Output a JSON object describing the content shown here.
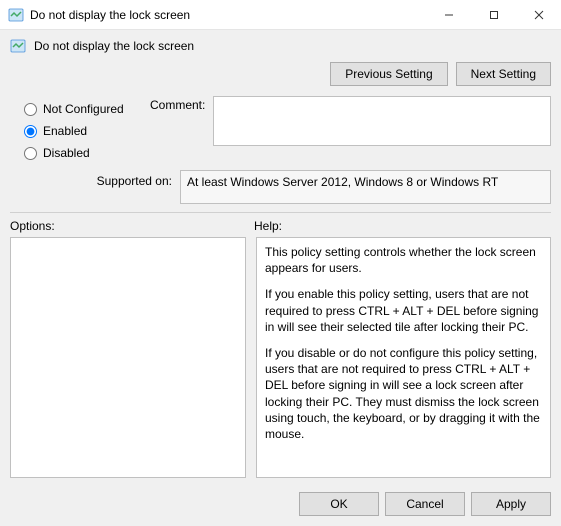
{
  "window": {
    "title": "Do not display the lock screen"
  },
  "header": {
    "title": "Do not display the lock screen"
  },
  "nav": {
    "previous": "Previous Setting",
    "next": "Next Setting"
  },
  "state": {
    "not_configured": "Not Configured",
    "enabled": "Enabled",
    "disabled": "Disabled",
    "selected": "enabled"
  },
  "labels": {
    "comment": "Comment:",
    "supported_on": "Supported on:",
    "options": "Options:",
    "help": "Help:"
  },
  "comment": "",
  "supported_on": "At least Windows Server 2012, Windows 8 or Windows RT",
  "help": {
    "p1": "This policy setting controls whether the lock screen appears for users.",
    "p2": "If you enable this policy setting, users that are not required to press CTRL + ALT + DEL before signing in will see their selected tile after locking their PC.",
    "p3": "If you disable or do not configure this policy setting, users that are not required to press CTRL + ALT + DEL before signing in will see a lock screen after locking their PC. They must dismiss the lock screen using touch, the keyboard, or by dragging it with the mouse."
  },
  "footer": {
    "ok": "OK",
    "cancel": "Cancel",
    "apply": "Apply"
  }
}
